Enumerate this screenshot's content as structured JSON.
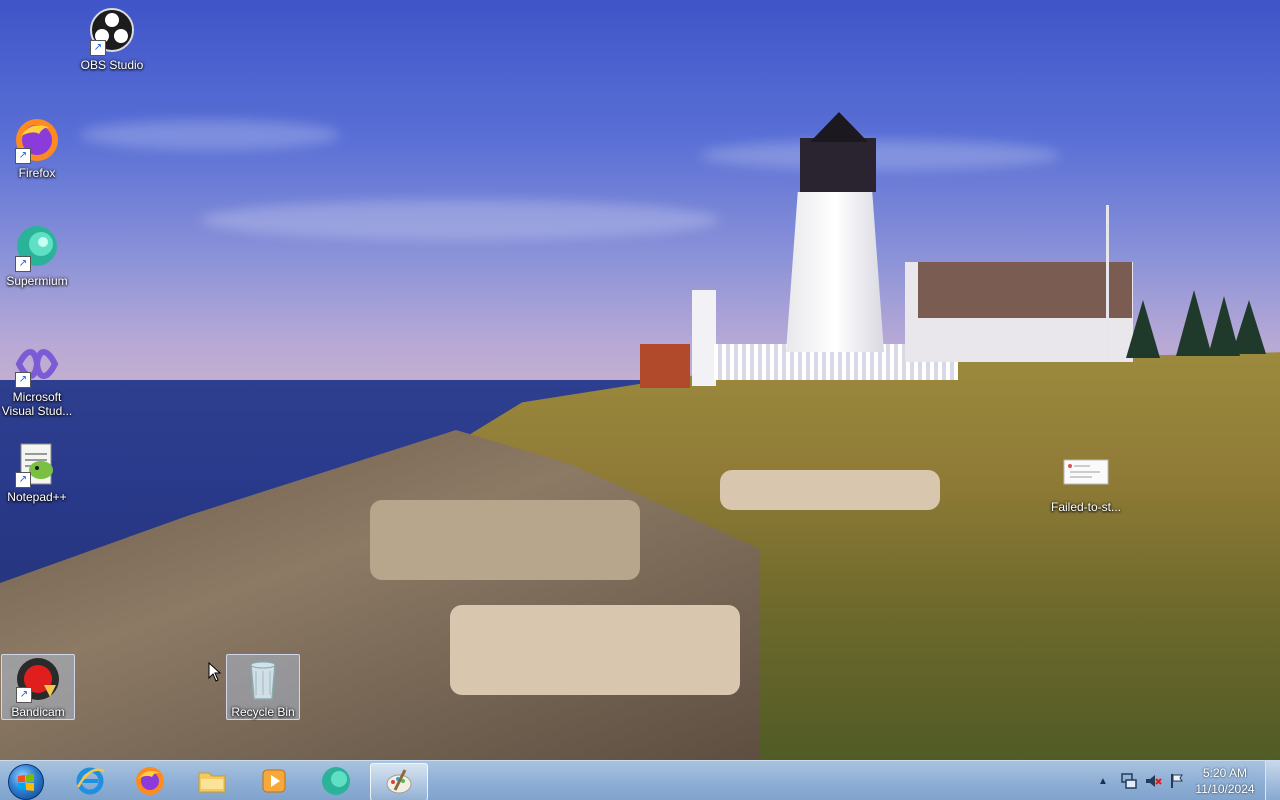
{
  "desktop": {
    "icons": [
      {
        "label": "OBS Studio",
        "icon": "obs-icon"
      },
      {
        "label": "Firefox",
        "icon": "firefox-icon"
      },
      {
        "label": "Supermium",
        "icon": "supermium-icon"
      },
      {
        "label": "Microsoft Visual Stud...",
        "icon": "visual-studio-icon"
      },
      {
        "label": "Notepad++",
        "icon": "notepad-plus-plus-icon"
      },
      {
        "label": "Failed-to-st...",
        "icon": "image-file-icon"
      },
      {
        "label": "Bandicam",
        "icon": "bandicam-icon"
      },
      {
        "label": "Recycle Bin",
        "icon": "recycle-bin-icon"
      }
    ]
  },
  "taskbar": {
    "start_icon": "windows-start-icon",
    "pinned": [
      {
        "name": "internet-explorer",
        "icon": "internet-explorer-icon"
      },
      {
        "name": "firefox",
        "icon": "firefox-icon"
      },
      {
        "name": "file-explorer",
        "icon": "folder-icon"
      },
      {
        "name": "media-player",
        "icon": "media-player-icon"
      },
      {
        "name": "supermium",
        "icon": "supermium-icon"
      },
      {
        "name": "paint",
        "icon": "paint-icon"
      }
    ],
    "tray": {
      "icons": [
        "chevron-up-icon",
        "network-icon",
        "volume-muted-icon",
        "action-center-flag-icon"
      ]
    },
    "clock": {
      "time": "5:20 AM",
      "date": "11/10/2024"
    }
  },
  "colors": {
    "taskbar": "#8fb0d6",
    "sky_top": "#3f55c8",
    "sea": "#2a3a8c"
  }
}
